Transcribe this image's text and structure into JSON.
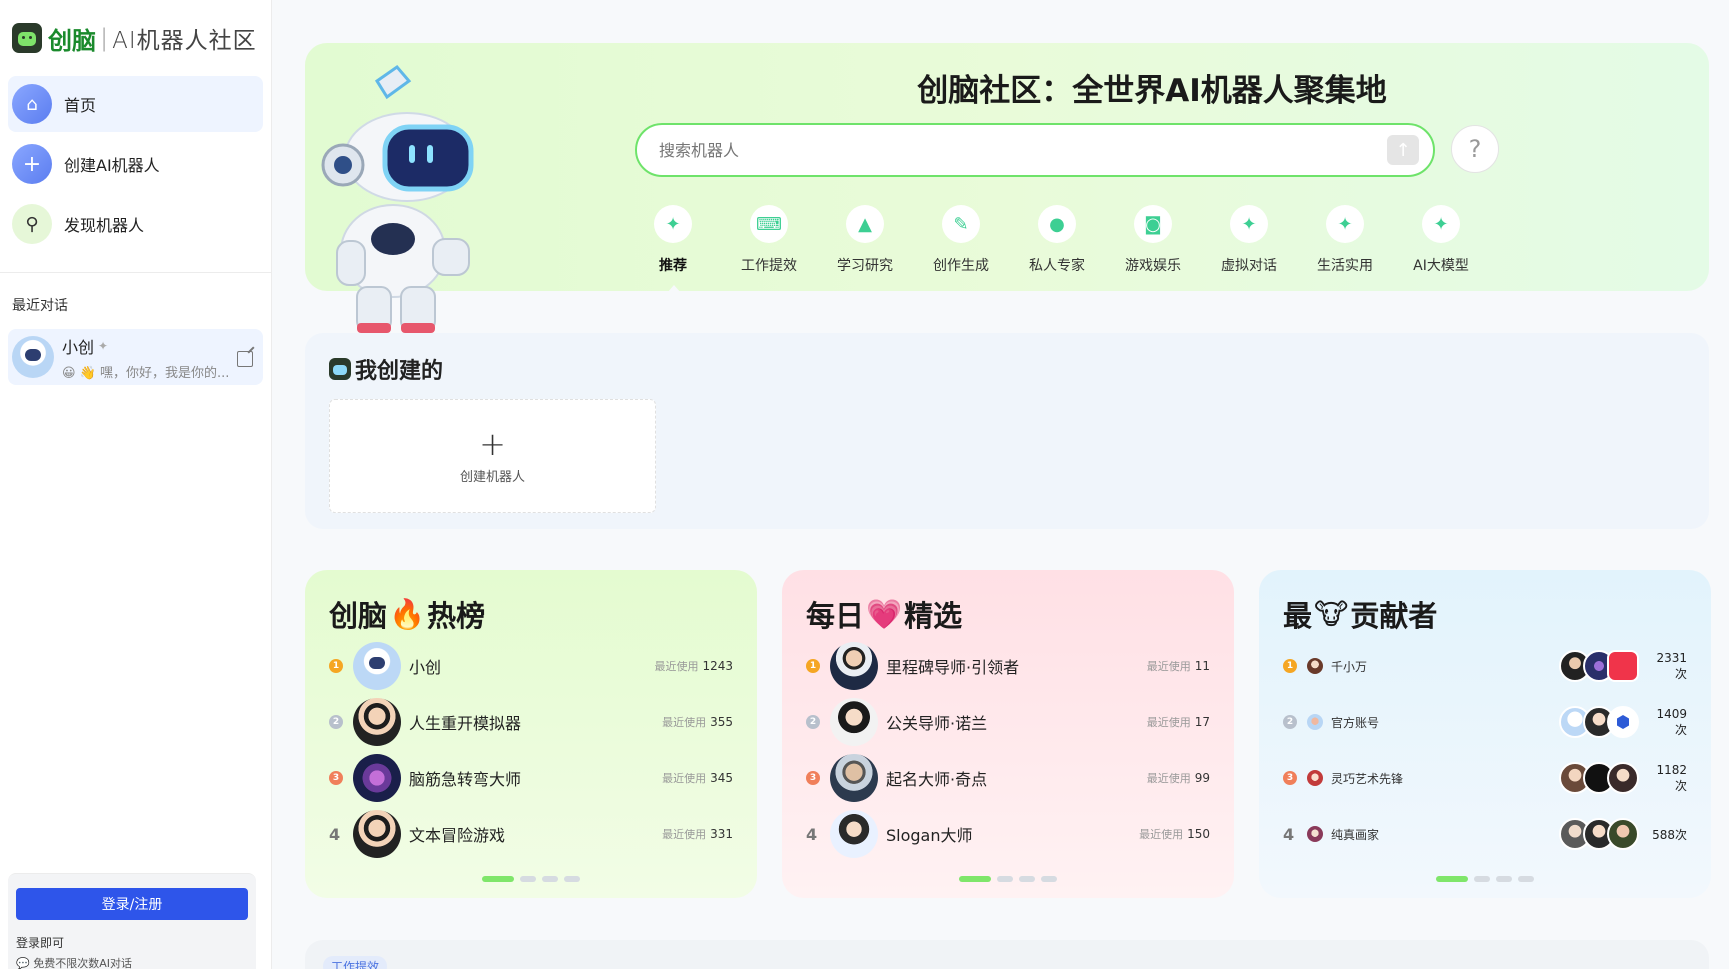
{
  "sidebar": {
    "brand": "创脑",
    "separator": "|",
    "subtitle": "AI机器人社区",
    "nav": [
      {
        "label": "首页",
        "icon": "home-icon"
      },
      {
        "label": "创建AI机器人",
        "icon": "plus-icon"
      },
      {
        "label": "发现机器人",
        "icon": "search-icon"
      }
    ],
    "recent_title": "最近对话",
    "recent": [
      {
        "name": "小创",
        "message": "😀 👋 嘿，你好，我是你的..."
      }
    ],
    "login_button": "登录/注册",
    "login_note": "登录即可",
    "login_perk": "💬 免费不限次数AI对话"
  },
  "hero": {
    "title": "创脑社区：全世界AI机器人聚集地",
    "search_placeholder": "搜索机器人",
    "help": "?",
    "categories": [
      {
        "label": "推荐",
        "icon": "sparkle-icon",
        "active": true
      },
      {
        "label": "工作提效",
        "icon": "keyboard-icon"
      },
      {
        "label": "学习研究",
        "icon": "graduation-cap-icon"
      },
      {
        "label": "创作生成",
        "icon": "pencil-icon"
      },
      {
        "label": "私人专家",
        "icon": "person-icon"
      },
      {
        "label": "游戏娱乐",
        "icon": "gamepad-icon"
      },
      {
        "label": "虚拟对话",
        "icon": "sparkle-icon"
      },
      {
        "label": "生活实用",
        "icon": "sparkle-icon"
      },
      {
        "label": "AI大模型",
        "icon": "sparkle-icon"
      }
    ]
  },
  "mine": {
    "title": "我创建的",
    "create_plus": "+",
    "create_label": "创建机器人"
  },
  "boards": {
    "hot": {
      "title_a": "创脑",
      "title_emoji": "🔥",
      "title_b": "热榜",
      "items": [
        {
          "rank": "1",
          "name": "小创",
          "meta_label": "最近使用",
          "meta_value": "1243"
        },
        {
          "rank": "2",
          "name": "人生重开模拟器",
          "meta_label": "最近使用",
          "meta_value": "355"
        },
        {
          "rank": "3",
          "name": "脑筋急转弯大师",
          "meta_label": "最近使用",
          "meta_value": "345"
        },
        {
          "rank": "4",
          "name": "文本冒险游戏",
          "meta_label": "最近使用",
          "meta_value": "331"
        }
      ]
    },
    "daily": {
      "title_a": "每日",
      "title_emoji": "💗",
      "title_b": "精选",
      "items": [
        {
          "rank": "1",
          "name": "里程碑导师·引领者",
          "meta_label": "最近使用",
          "meta_value": "11"
        },
        {
          "rank": "2",
          "name": "公关导师·诺兰",
          "meta_label": "最近使用",
          "meta_value": "17"
        },
        {
          "rank": "3",
          "name": "起名大师·奇点",
          "meta_label": "最近使用",
          "meta_value": "99"
        },
        {
          "rank": "4",
          "name": "Slogan大师",
          "meta_label": "最近使用",
          "meta_value": "150"
        }
      ]
    },
    "contrib": {
      "title_a": "最",
      "title_emoji": "🐮",
      "title_b": "贡献者",
      "items": [
        {
          "rank": "1",
          "name": "千小万",
          "count": "2331次"
        },
        {
          "rank": "2",
          "name": "官方账号",
          "count": "1409次"
        },
        {
          "rank": "3",
          "name": "灵巧艺术先锋",
          "count": "1182次"
        },
        {
          "rank": "4",
          "name": "纯真画家",
          "count": "588次"
        }
      ]
    }
  },
  "bottom": {
    "tag": "工作提效"
  },
  "colors": {
    "accent_green": "#6ee36a",
    "brand_green": "#1a8a2c",
    "login_blue": "#2e55ea"
  }
}
